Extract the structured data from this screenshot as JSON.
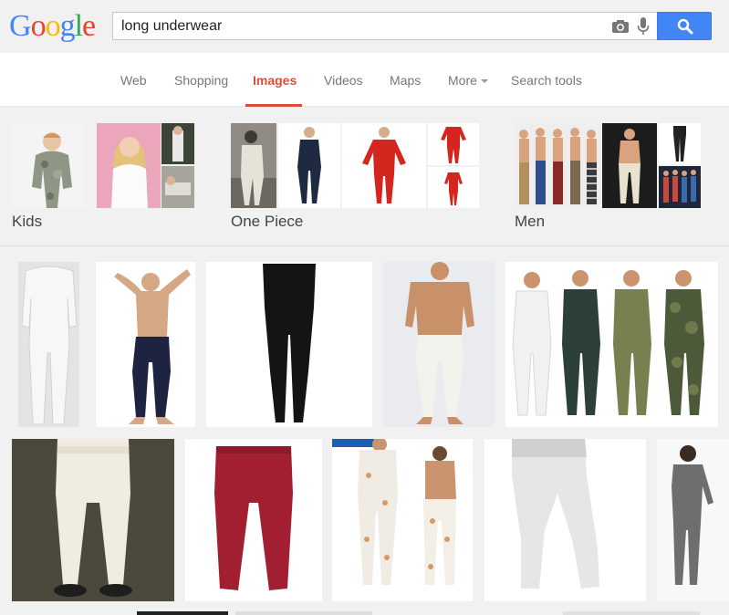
{
  "logo": {
    "letters": [
      "G",
      "o",
      "o",
      "g",
      "l",
      "e"
    ],
    "colors": [
      "#4285f4",
      "#ea4335",
      "#fbbc05",
      "#4285f4",
      "#34a853",
      "#ea4335"
    ]
  },
  "search": {
    "query": "long underwear"
  },
  "tabs": [
    {
      "label": "Web",
      "active": false
    },
    {
      "label": "Shopping",
      "active": false
    },
    {
      "label": "Images",
      "active": true
    },
    {
      "label": "Videos",
      "active": false
    },
    {
      "label": "Maps",
      "active": false
    },
    {
      "label": "More",
      "active": false,
      "dropdown": true
    },
    {
      "label": "Search tools",
      "active": false
    }
  ],
  "categories": [
    {
      "label": "Kids"
    },
    {
      "label": "One Piece"
    },
    {
      "label": "Men"
    }
  ],
  "colors": {
    "accent_red": "#dd4b39",
    "search_blue": "#4285f4"
  }
}
